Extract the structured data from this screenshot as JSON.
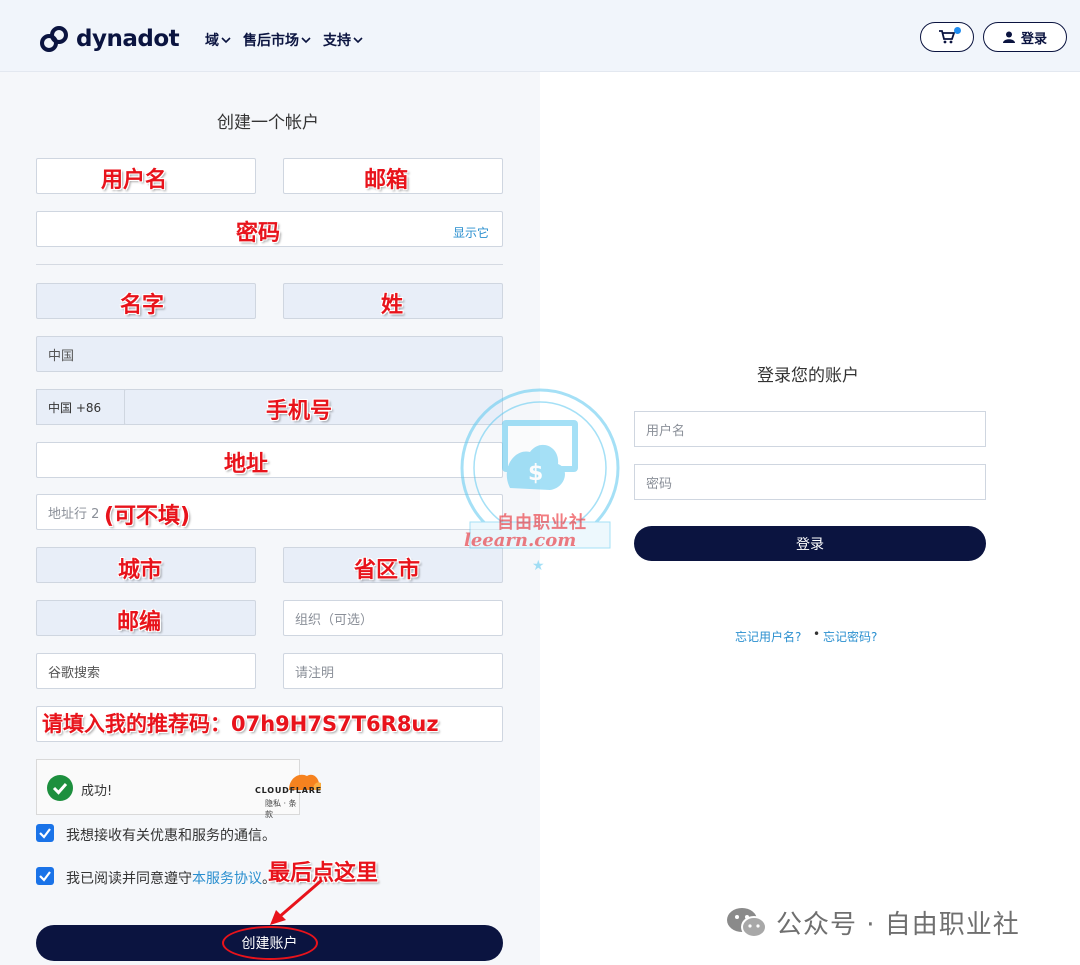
{
  "header": {
    "brand": "dynadot",
    "nav": [
      "域",
      "售后市场",
      "支持"
    ],
    "login_label": "登录"
  },
  "register": {
    "title": "创建一个帐户",
    "show_password": "显示它",
    "country_value": "中国",
    "phone_prefix": "中国 +86",
    "address2_placeholder": "地址行 2",
    "org_placeholder": "组织（可选）",
    "source_value": "谷歌搜索",
    "note_placeholder": "请注明",
    "captcha": {
      "status": "成功!",
      "brand": "CLOUDFLARE",
      "links": "隐私 · 条款"
    },
    "opt_in_label": "我想接收有关优惠和服务的通信。",
    "tos_prefix": "我已阅读并同意遵守",
    "tos_link": "本服务协议",
    "tos_suffix": "。",
    "submit_label": "创建账户"
  },
  "annotations": {
    "username": "用户名",
    "email": "邮箱",
    "password": "密码",
    "first_name": "名字",
    "last_name": "姓",
    "phone": "手机号",
    "address": "地址",
    "address2": "(可不填)",
    "city": "城市",
    "state": "省区市",
    "zip": "邮编",
    "referral": "请填入我的推荐码：07h9H7S7T6R8uz",
    "final_click": "最后点这里"
  },
  "login": {
    "title": "登录您的账户",
    "username_placeholder": "用户名",
    "password_placeholder": "密码",
    "submit_label": "登录",
    "forgot_username": "忘记用户名?",
    "separator": "•",
    "forgot_password": "忘记密码?"
  },
  "watermark": {
    "line1": "自由职业社",
    "line2": "leearn.com"
  },
  "footer": {
    "wechat_text": "公众号 · 自由职业社"
  },
  "colors": {
    "navy": "#0b1440",
    "link": "#2a8fcf",
    "annotation": "#e8131b",
    "check": "#1a73e8"
  }
}
